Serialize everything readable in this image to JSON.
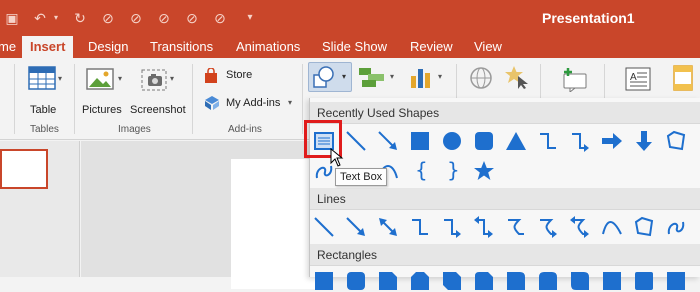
{
  "app": {
    "title": "Presentation1"
  },
  "tabs": [
    "me",
    "Insert",
    "Design",
    "Transitions",
    "Animations",
    "Slide Show",
    "Review",
    "View"
  ],
  "ribbon": {
    "table_label": "Table",
    "pictures_label": "Pictures",
    "screenshot_label": "Screenshot",
    "store_label": "Store",
    "addins_label": "My Add-ins",
    "groups": {
      "tables": "Tables",
      "images": "Images",
      "addins": "Add-ins"
    }
  },
  "shapes_menu": {
    "sections": [
      "Recently Used Shapes",
      "Lines",
      "Rectangles"
    ],
    "tooltip": "Text Box",
    "text_symbols": [
      "{",
      "}"
    ]
  },
  "colors": {
    "accent": "#c9462a",
    "shape_blue": "#1e6fce",
    "highlight": "#e01c1c"
  },
  "icons": [
    "save-icon",
    "undo-icon",
    "redo-icon",
    "shapes-icon",
    "smartart-icon",
    "chart-icon",
    "hyperlink-icon",
    "action-icon",
    "comment-icon",
    "textbox-icon",
    "header-footer-icon"
  ]
}
